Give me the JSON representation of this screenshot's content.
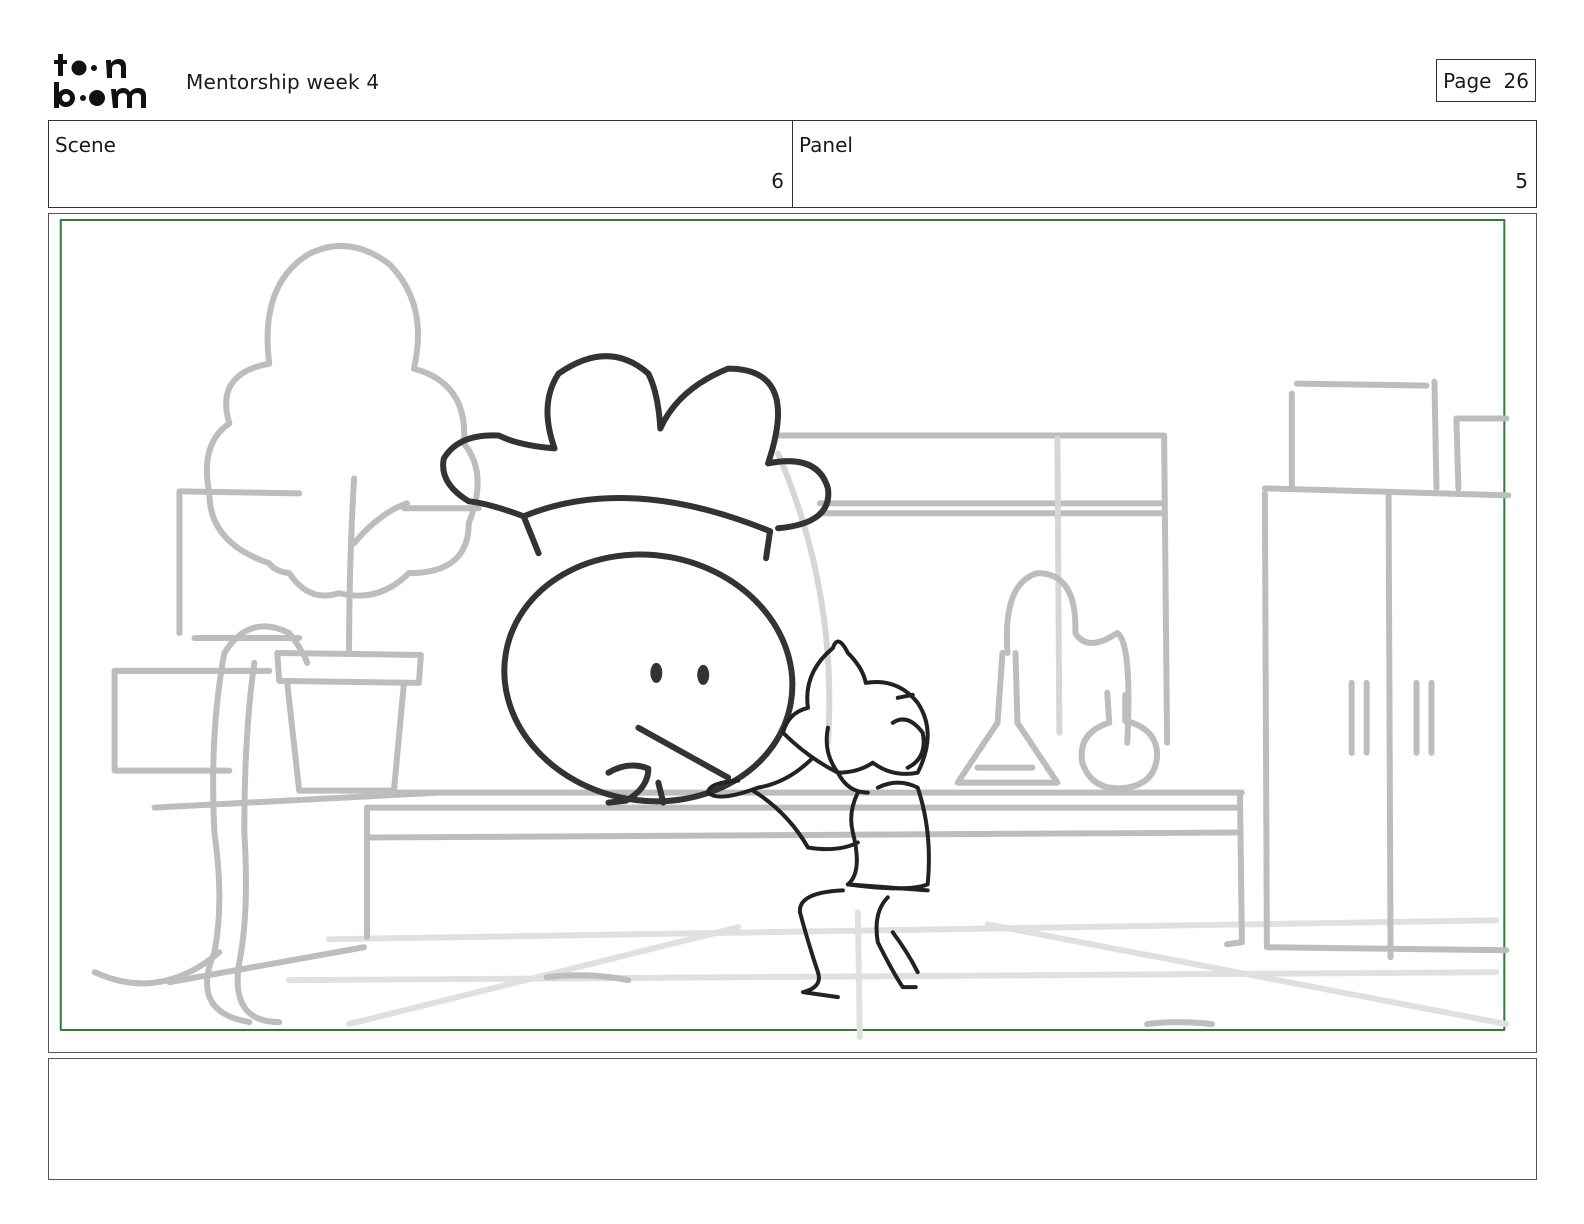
{
  "header": {
    "logo_text": "toon boom",
    "document_title": "Mentorship week 4",
    "page_label": "Page",
    "page_number": "26"
  },
  "fields": {
    "scene_label": "Scene",
    "scene_value": "6",
    "panel_label": "Panel",
    "panel_value": "5"
  },
  "panel": {
    "safe_frame_color": "#2e7d32",
    "sketch_dark": "#2a2a2a",
    "sketch_light": "#bdbdbd"
  },
  "notes": {
    "text": ""
  }
}
